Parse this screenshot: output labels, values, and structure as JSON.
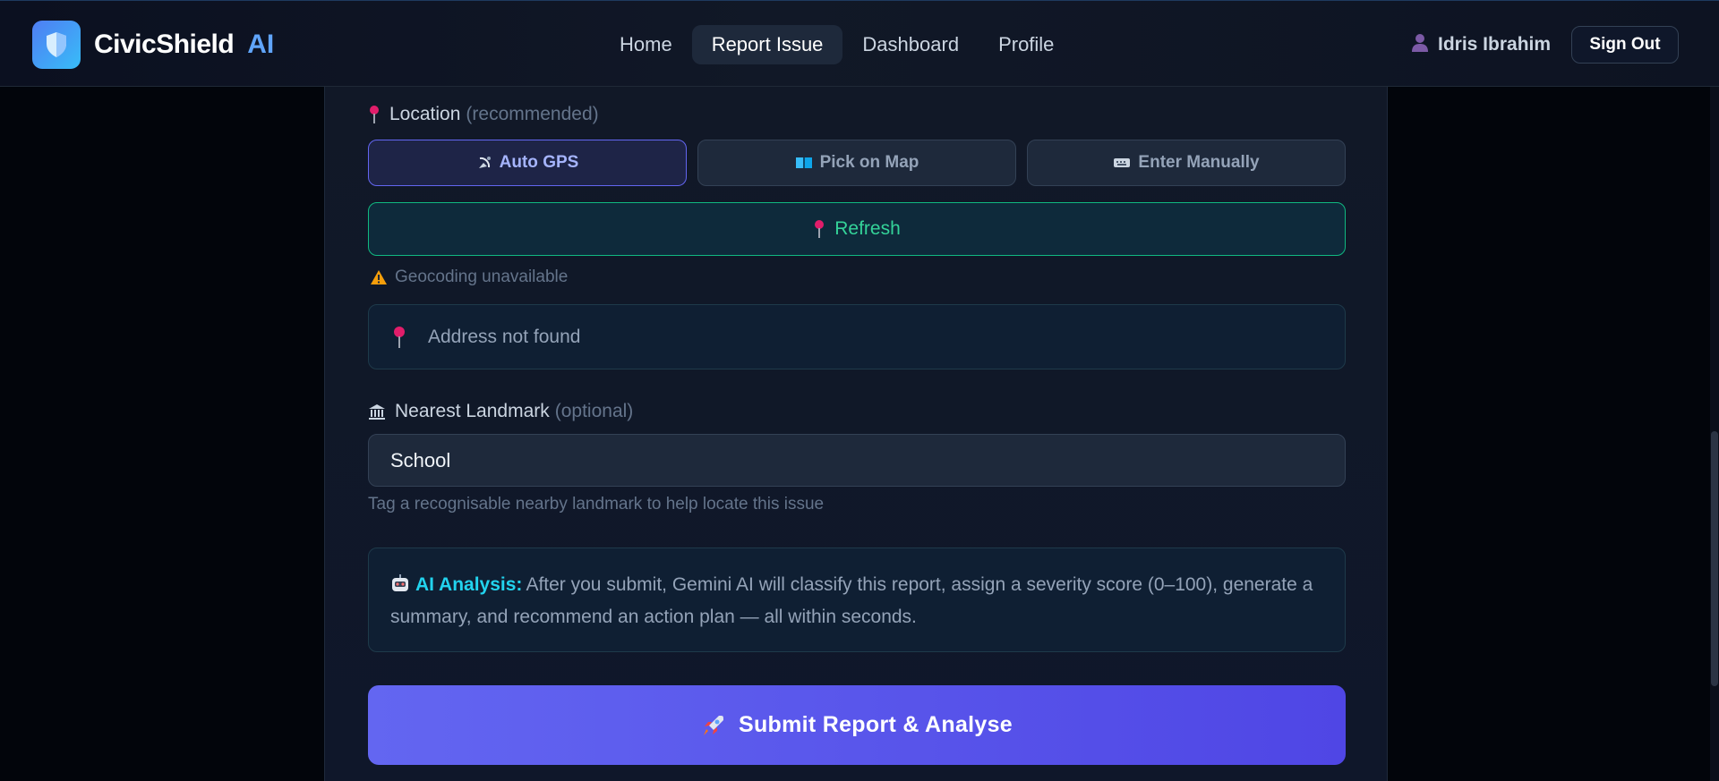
{
  "brand": {
    "name": "CivicShield",
    "suffix": "AI"
  },
  "nav": {
    "items": [
      {
        "label": "Home"
      },
      {
        "label": "Report Issue",
        "active": true
      },
      {
        "label": "Dashboard"
      },
      {
        "label": "Profile"
      }
    ]
  },
  "user": {
    "name": "Idris Ibrahim",
    "signout_label": "Sign Out"
  },
  "location": {
    "label": "Location",
    "hint": "(recommended)",
    "modes": [
      {
        "label": "Auto GPS",
        "icon": "satellite-dish-icon",
        "active": true
      },
      {
        "label": "Pick on Map",
        "icon": "map-book-icon"
      },
      {
        "label": "Enter Manually",
        "icon": "keyboard-icon"
      }
    ],
    "refresh_label": "Refresh",
    "warning": "Geocoding unavailable",
    "address": "Address not found"
  },
  "landmark": {
    "label": "Nearest Landmark",
    "hint": "(optional)",
    "value": "School",
    "help": "Tag a recognisable nearby landmark to help locate this issue"
  },
  "ai_analysis": {
    "title": "AI Analysis:",
    "text": "After you submit, Gemini AI will classify this report, assign a severity score (0–100), generate a summary, and recommend an action plan — all within seconds."
  },
  "submit_label": "Submit Report & Analyse",
  "colors": {
    "accent": "#6366f1",
    "success": "#10b981",
    "brand_ai": "#60a5fa",
    "highlight": "#22d3ee"
  }
}
